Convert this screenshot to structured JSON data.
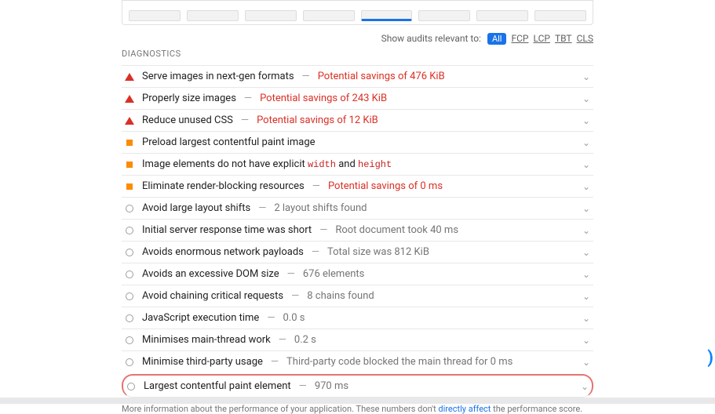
{
  "thumbnails": [
    {
      "active": false
    },
    {
      "active": false
    },
    {
      "active": false
    },
    {
      "active": false
    },
    {
      "active": true
    },
    {
      "active": false
    },
    {
      "active": false
    },
    {
      "active": false
    }
  ],
  "relevance": {
    "label": "Show audits relevant to:",
    "filters": [
      "All",
      "FCP",
      "LCP",
      "TBT",
      "CLS"
    ]
  },
  "section_title": "DIAGNOSTICS",
  "audits": [
    {
      "status": "fail",
      "title": "Serve images in next-gen formats",
      "detail": "Potential savings of 476 KiB",
      "detail_red": true
    },
    {
      "status": "fail",
      "title": "Properly size images",
      "detail": "Potential savings of 243 KiB",
      "detail_red": true
    },
    {
      "status": "fail",
      "title": "Reduce unused CSS",
      "detail": "Potential savings of 12 KiB",
      "detail_red": true
    },
    {
      "status": "warn",
      "title": "Preload largest contentful paint image",
      "detail": "",
      "detail_red": false
    },
    {
      "status": "warn",
      "title_html": true,
      "title_parts": [
        "Image elements do not have explicit ",
        "width",
        " and ",
        "height"
      ],
      "detail": "",
      "detail_red": false
    },
    {
      "status": "warn",
      "title": "Eliminate render-blocking resources",
      "detail": "Potential savings of 0 ms",
      "detail_red": true
    },
    {
      "status": "pass",
      "title": "Avoid large layout shifts",
      "detail": "2 layout shifts found",
      "detail_red": false
    },
    {
      "status": "pass",
      "title": "Initial server response time was short",
      "detail": "Root document took 40 ms",
      "detail_red": false
    },
    {
      "status": "pass",
      "title": "Avoids enormous network payloads",
      "detail": "Total size was 812 KiB",
      "detail_red": false
    },
    {
      "status": "pass",
      "title": "Avoids an excessive DOM size",
      "detail": "676 elements",
      "detail_red": false
    },
    {
      "status": "pass",
      "title": "Avoid chaining critical requests",
      "detail": "8 chains found",
      "detail_red": false
    },
    {
      "status": "pass",
      "title": "JavaScript execution time",
      "detail": "0.0 s",
      "detail_red": false
    },
    {
      "status": "pass",
      "title": "Minimises main-thread work",
      "detail": "0.2 s",
      "detail_red": false
    },
    {
      "status": "pass",
      "title": "Minimise third-party usage",
      "detail": "Third-party code blocked the main thread for 0 ms",
      "detail_red": false
    },
    {
      "status": "pass",
      "title": "Largest contentful paint element",
      "detail": "970 ms",
      "detail_red": false,
      "highlighted": true
    }
  ],
  "footer": {
    "pre": "More information about the performance of your application. These numbers don't ",
    "link": "directly affect",
    "post": " the performance score."
  }
}
